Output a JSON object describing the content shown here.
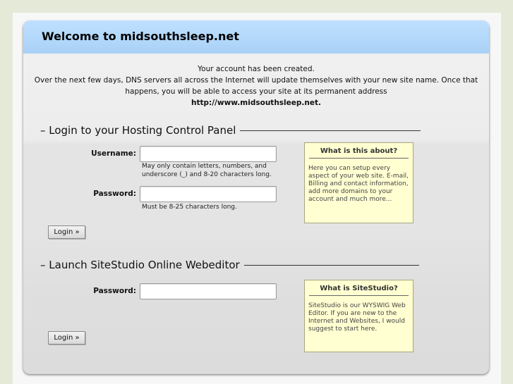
{
  "header": {
    "title": "Welcome to midsouthsleep.net"
  },
  "intro": {
    "line1": "Your account has been created.",
    "line2": "Over the next few days, DNS servers all across the Internet will update themselves with your new site name. Once that",
    "line3": "happens, you will be able to access your site at its permanent address",
    "address": "http://www.midsouthsleep.net."
  },
  "control_panel": {
    "heading": "– Login to your Hosting Control Panel",
    "username_label": "Username:",
    "username_value": "",
    "username_hint": "May only contain letters, numbers, and underscore (_) and 8-20 characters long.",
    "password_label": "Password:",
    "password_value": "",
    "password_hint": "Must be 8-25 characters long.",
    "login_button": "Login »",
    "info_title": "What is this about?",
    "info_text": "Here you can setup every aspect of your web site. E-mail, Billing and contact information, add more domains to your account and much more..."
  },
  "sitestudio": {
    "heading": "– Launch SiteStudio Online Webeditor",
    "password_label": "Password:",
    "password_value": "",
    "login_button": "Login »",
    "info_title": "What is SiteStudio?",
    "info_text": "SiteStudio is our WYSWIG Web Editor. If you are new to the Internet and Websites, I would suggest to start here."
  }
}
